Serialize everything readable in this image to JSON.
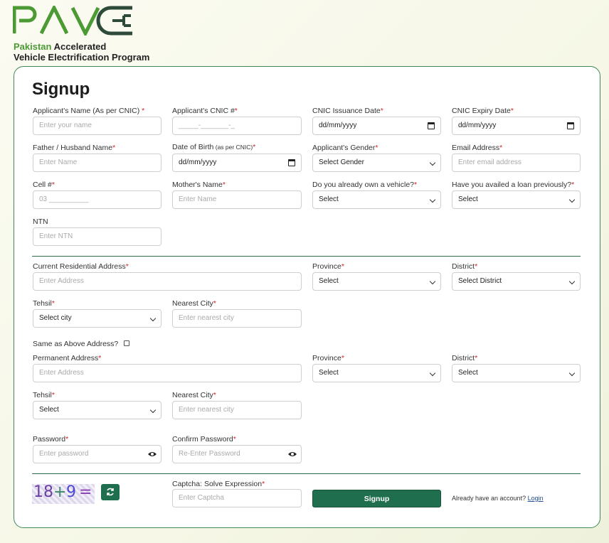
{
  "brand": {
    "logo_text": "PAVE",
    "line1_green": "Pakistan",
    "line1_rest": " Accelerated",
    "line2": "Vehicle Electrification Program",
    "green": "#4b9a34",
    "dark": "#2d4a3b"
  },
  "form": {
    "title": "Signup",
    "applicant_name": {
      "label": "Applicant's Name (As per CNIC)",
      "req": " *",
      "placeholder": "Enter your name"
    },
    "cnic": {
      "label": "Applicant's CNIC #",
      "req": "*",
      "placeholder": "_____-_______-_"
    },
    "cnic_issue": {
      "label": "CNIC Issuance Date",
      "req": "*",
      "value": "dd/mm/yyyy"
    },
    "cnic_expiry": {
      "label": "CNIC Expiry Date",
      "req": "*",
      "value": "dd/mm/yyyy"
    },
    "father_name": {
      "label": "Father / Husband Name",
      "req": "*",
      "placeholder": "Enter Name"
    },
    "dob": {
      "label": "Date of Birth",
      "label_small": " (as per CNIC)",
      "req": "*",
      "value": "dd/mm/yyyy"
    },
    "gender": {
      "label": "Applicant's Gender",
      "req": "*",
      "value": "Select Gender"
    },
    "email": {
      "label": "Email Address",
      "req": "*",
      "placeholder": "Enter email address"
    },
    "cell": {
      "label": "Cell #",
      "req": "*",
      "placeholder": "03 __________"
    },
    "mother_name": {
      "label": "Mother's Name",
      "req": "*",
      "placeholder": "Enter Name"
    },
    "own_vehicle": {
      "label": "Do you already own a vehicle?",
      "req": "*",
      "value": "Select"
    },
    "loan_before": {
      "label": "Have you availed a loan previously?",
      "req": "*",
      "value": "Select"
    },
    "ntn": {
      "label": "NTN",
      "placeholder": "Enter NTN"
    },
    "current_address": {
      "label": "Current Residential Address",
      "req": "*",
      "placeholder": "Enter Address"
    },
    "province1": {
      "label": "Province",
      "req": "*",
      "value": "Select"
    },
    "district1": {
      "label": "District",
      "req": "*",
      "value": "Select District"
    },
    "tehsil1": {
      "label": "Tehsil",
      "req": "*",
      "value": "Select city"
    },
    "nearest_city1": {
      "label": "Nearest City",
      "req": "*",
      "placeholder": "Enter nearest city"
    },
    "same_as_above": {
      "label": "Same as Above Address?"
    },
    "permanent_address": {
      "label": "Permanent Address",
      "req": "*",
      "placeholder": "Enter Address"
    },
    "province2": {
      "label": "Province",
      "req": "*",
      "value": "Select"
    },
    "district2": {
      "label": "District",
      "req": "*",
      "value": "Select"
    },
    "tehsil2": {
      "label": "Tehsil",
      "req": "*",
      "value": "Select"
    },
    "nearest_city2": {
      "label": "Nearest City",
      "req": "*",
      "placeholder": "Enter nearest city"
    },
    "password": {
      "label": "Password",
      "req": "*",
      "placeholder": "Enter password"
    },
    "confirm_password": {
      "label": "Confirm Password",
      "req": "*",
      "placeholder": "Re-Enter Password"
    },
    "captcha": {
      "label": "Captcha: Solve Expression",
      "req": "*",
      "placeholder": "Enter Captcha",
      "img_a": "18",
      "img_op": "+",
      "img_b": "9",
      "img_eq": "="
    },
    "signup_button": "Signup",
    "already_text": "Already have an account? ",
    "login_link": "Login"
  }
}
